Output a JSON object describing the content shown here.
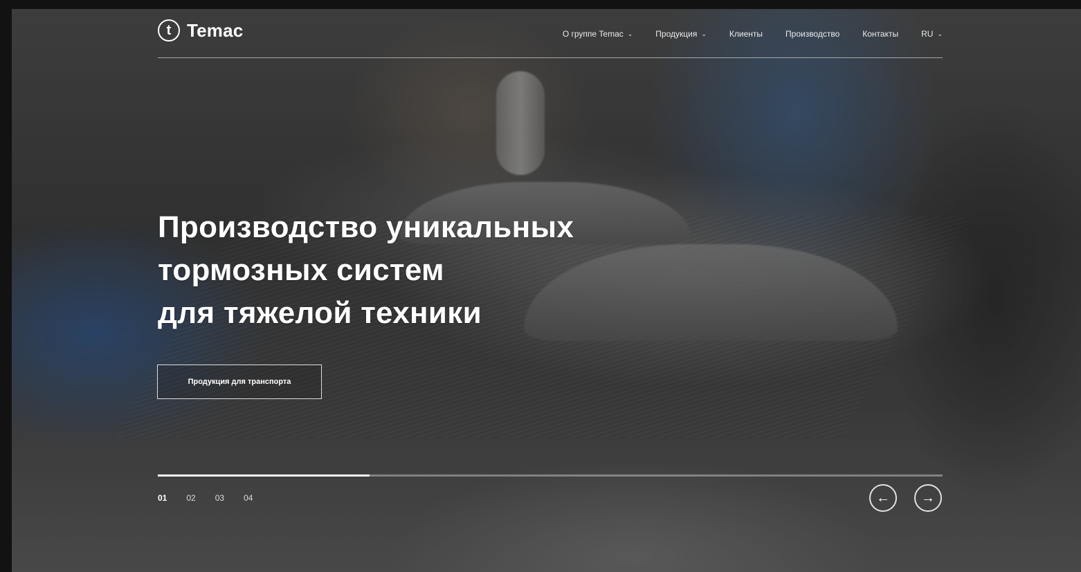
{
  "brand": {
    "logo_letter": "t",
    "name": "Temac"
  },
  "nav": {
    "items": [
      {
        "label": "О группе Temac",
        "has_dropdown": true
      },
      {
        "label": "Продукция",
        "has_dropdown": true
      },
      {
        "label": "Клиенты",
        "has_dropdown": false
      },
      {
        "label": "Производство",
        "has_dropdown": false
      },
      {
        "label": "Контакты",
        "has_dropdown": false
      }
    ],
    "language": {
      "label": "RU",
      "has_dropdown": true
    },
    "dropdown_icon": "chevron-down-icon"
  },
  "hero": {
    "title_lines": [
      "Производство уникальных",
      "тормозных систем",
      "для тяжелой техники"
    ],
    "cta_label": "Продукция для транспорта"
  },
  "slider": {
    "slides": [
      "01",
      "02",
      "03",
      "04"
    ],
    "active_index": 0,
    "progress_fraction": 0.27,
    "prev_icon": "arrow-left-icon",
    "next_icon": "arrow-right-icon"
  },
  "colors": {
    "text": "#ffffff",
    "page_background": "#121212"
  }
}
